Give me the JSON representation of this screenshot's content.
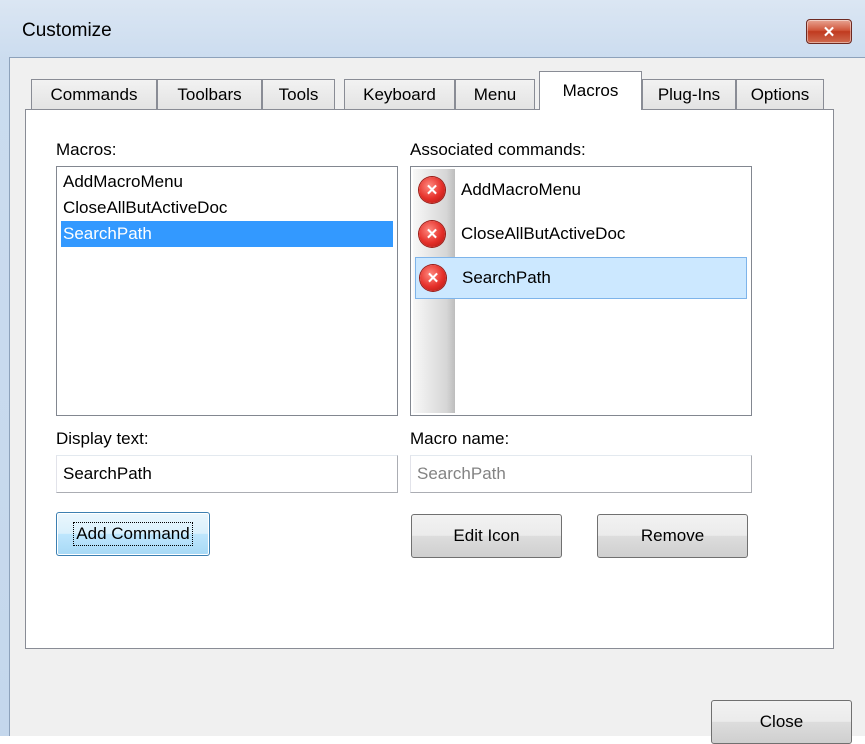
{
  "window": {
    "title": "Customize",
    "close_glyph": "✕"
  },
  "tabs": [
    {
      "label": "Commands"
    },
    {
      "label": "Toolbars"
    },
    {
      "label": "Tools"
    },
    {
      "label": "Keyboard"
    },
    {
      "label": "Menu"
    },
    {
      "label": "Macros",
      "active": true
    },
    {
      "label": "Plug-Ins"
    },
    {
      "label": "Options"
    }
  ],
  "macros": {
    "label": "Macros:",
    "items": [
      "AddMacroMenu",
      "CloseAllButActiveDoc",
      "SearchPath"
    ],
    "selected": "SearchPath"
  },
  "associated": {
    "label": "Associated commands:",
    "items": [
      "AddMacroMenu",
      "CloseAllButActiveDoc",
      "SearchPath"
    ],
    "selected": "SearchPath",
    "icon": "error-icon"
  },
  "display_text": {
    "label": "Display text:",
    "value": "SearchPath"
  },
  "macro_name": {
    "label": "Macro name:",
    "value": "SearchPath"
  },
  "buttons": {
    "add_command": "Add Command",
    "edit_icon": "Edit Icon",
    "remove": "Remove",
    "close": "Close"
  }
}
